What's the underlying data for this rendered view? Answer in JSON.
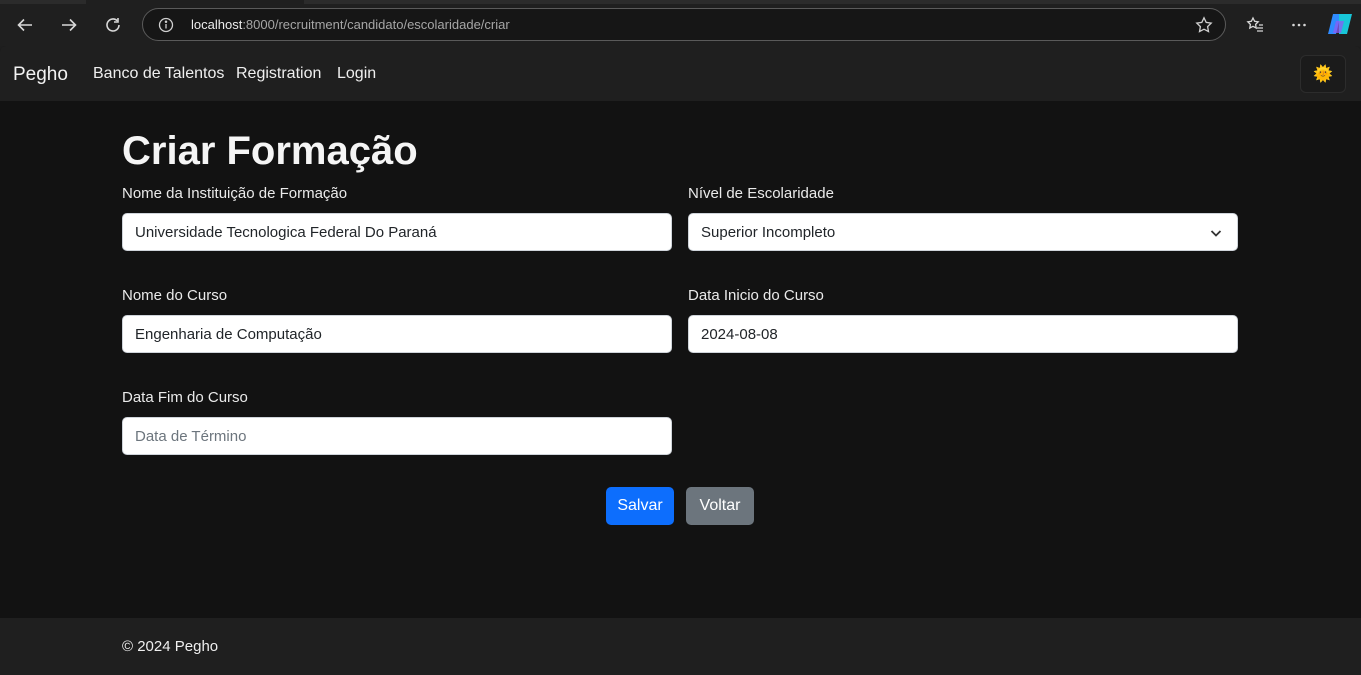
{
  "browser": {
    "url_host": "localhost",
    "url_path": ":8000/recruitment/candidato/escolaridade/criar"
  },
  "navbar": {
    "brand": "Pegho",
    "links": [
      "Banco de Talentos",
      "Registration",
      "Login"
    ],
    "theme_icon": "🌞"
  },
  "form": {
    "title": "Criar Formação",
    "institution_label": "Nome da Instituição de Formação",
    "institution_value": "Universidade Tecnologica Federal Do Paraná",
    "level_label": "Nível de Escolaridade",
    "level_value": "Superior Incompleto",
    "course_label": "Nome do Curso",
    "course_value": "Engenharia de Computação",
    "start_label": "Data Inicio do Curso",
    "start_value": "2024-08-08",
    "end_label": "Data Fim do Curso",
    "end_placeholder": "Data de Término",
    "save_label": "Salvar",
    "back_label": "Voltar"
  },
  "footer": {
    "text": "© 2024 Pegho"
  },
  "colors": {
    "primary": "#0d6efd",
    "secondary": "#6c757d",
    "page_bg": "#121212",
    "navbar_bg": "#1f1f1f"
  }
}
